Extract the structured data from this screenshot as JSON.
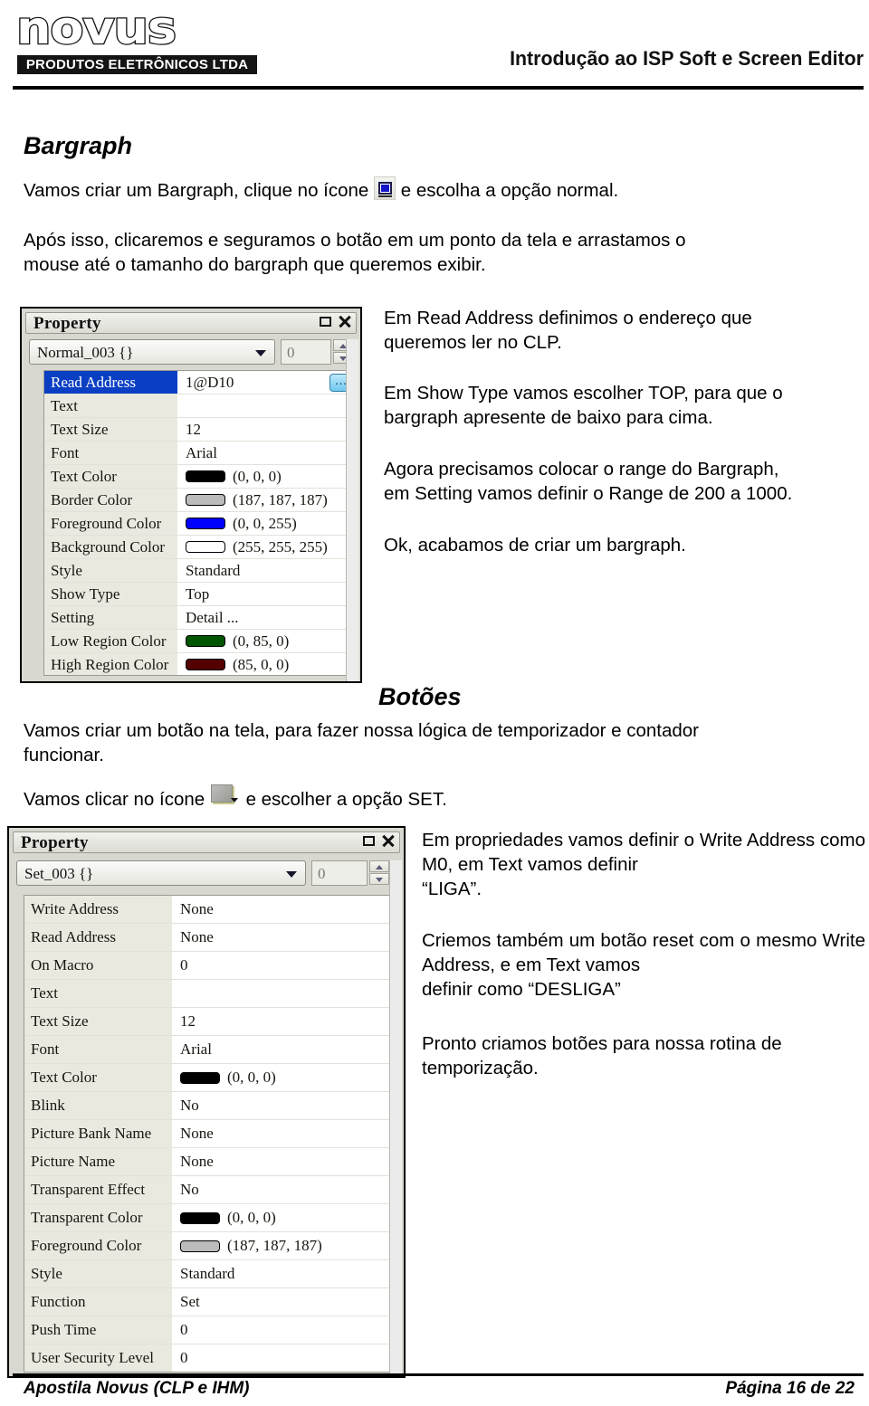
{
  "header": {
    "logo_word": "novus",
    "logo_subtitle": "PRODUTOS ELETRÔNICOS LTDA",
    "title": "Introdução ao ISP Soft e Screen Editor"
  },
  "sections": {
    "bargraph_title": "Bargraph",
    "botoes_title": "Botões"
  },
  "body": {
    "intro_before_icon": "Vamos criar um Bargraph, clique no ícone",
    "intro_after_icon": "e escolha a opção normal.",
    "drag_text": "Após isso, clicaremos e seguramos o botão em um ponto da tela e arrastamos o",
    "drag_text_line2": "mouse até o tamanho do bargraph que queremos exibir.",
    "botoes_line1": "Vamos criar um botão na tela, para fazer nossa lógica  de temporizador e contador",
    "botoes_line2": "funcionar.",
    "botoes_click_before": "Vamos clicar no ícone",
    "botoes_click_after": "e escolher a opção SET."
  },
  "right_column_top": {
    "p1": "Em Read Address definimos o endereço que",
    "p1_line2": "queremos ler no CLP.",
    "p2": "Em Show Type vamos escolher TOP, para que o",
    "p2_line2": "bargraph apresente de baixo para cima.",
    "p3": "Agora precisamos colocar o range do Bargraph,",
    "p3_line2": "em Setting vamos definir o Range de 200 a 1000.",
    "p4": "Ok, acabamos de criar um bargraph."
  },
  "right_column_bottom": {
    "p5": "Em propriedades vamos definir o Write Address como M0, em Text vamos definir",
    "p5_line3": "“LIGA”.",
    "p6": "Criemos também um botão reset com o mesmo Write Address, e em Text vamos",
    "p6_line3": "definir  como “DESLIGA”",
    "p7": "Pronto criamos botões para nossa rotina de",
    "p7_line2": "temporização."
  },
  "panel_bargraph": {
    "window_title": "Property",
    "object_name": "Normal_003 {}",
    "spin_value": "0",
    "browse_label": "...",
    "rows": [
      {
        "key": "Read Address",
        "value": "1@D10",
        "selected": true,
        "browse": true
      },
      {
        "key": "Text",
        "value": ""
      },
      {
        "key": "Text Size",
        "value": "12"
      },
      {
        "key": "Font",
        "value": "Arial"
      },
      {
        "key": "Text Color",
        "value": "(0, 0, 0)",
        "swatch": "#000000"
      },
      {
        "key": "Border Color",
        "value": "(187, 187, 187)",
        "swatch": "#bbbbbb"
      },
      {
        "key": "Foreground Color",
        "value": "(0, 0, 255)",
        "swatch": "#0000ff"
      },
      {
        "key": "Background Color",
        "value": "(255, 255, 255)",
        "swatch": "#ffffff"
      },
      {
        "key": "Style",
        "value": "Standard"
      },
      {
        "key": "Show Type",
        "value": "Top"
      },
      {
        "key": "Setting",
        "value": "Detail ..."
      },
      {
        "key": "Low Region Color",
        "value": "(0, 85, 0)",
        "swatch": "#005500"
      },
      {
        "key": "High Region Color",
        "value": "(85, 0, 0)",
        "swatch": "#550000"
      }
    ]
  },
  "panel_button": {
    "window_title": "Property",
    "object_name": "Set_003 {}",
    "spin_value": "0",
    "rows": [
      {
        "key": "Write Address",
        "value": "None"
      },
      {
        "key": "Read Address",
        "value": "None"
      },
      {
        "key": "On Macro",
        "value": "0"
      },
      {
        "key": "Text",
        "value": ""
      },
      {
        "key": "Text Size",
        "value": "12"
      },
      {
        "key": "Font",
        "value": "Arial"
      },
      {
        "key": "Text Color",
        "value": "(0, 0, 0)",
        "swatch": "#000000"
      },
      {
        "key": "Blink",
        "value": "No"
      },
      {
        "key": "Picture Bank Name",
        "value": "None"
      },
      {
        "key": "Picture Name",
        "value": "None"
      },
      {
        "key": "Transparent Effect",
        "value": "No"
      },
      {
        "key": "Transparent Color",
        "value": "(0, 0, 0)",
        "swatch": "#000000"
      },
      {
        "key": "Foreground Color",
        "value": "(187, 187, 187)",
        "swatch": "#bbbbbb"
      },
      {
        "key": "Style",
        "value": "Standard"
      },
      {
        "key": "Function",
        "value": "Set"
      },
      {
        "key": "Push Time",
        "value": "0"
      },
      {
        "key": "User Security Level",
        "value": "0"
      }
    ]
  },
  "footer": {
    "left": "Apostila Novus (CLP e IHM)",
    "right": "Página 16 de 22"
  }
}
